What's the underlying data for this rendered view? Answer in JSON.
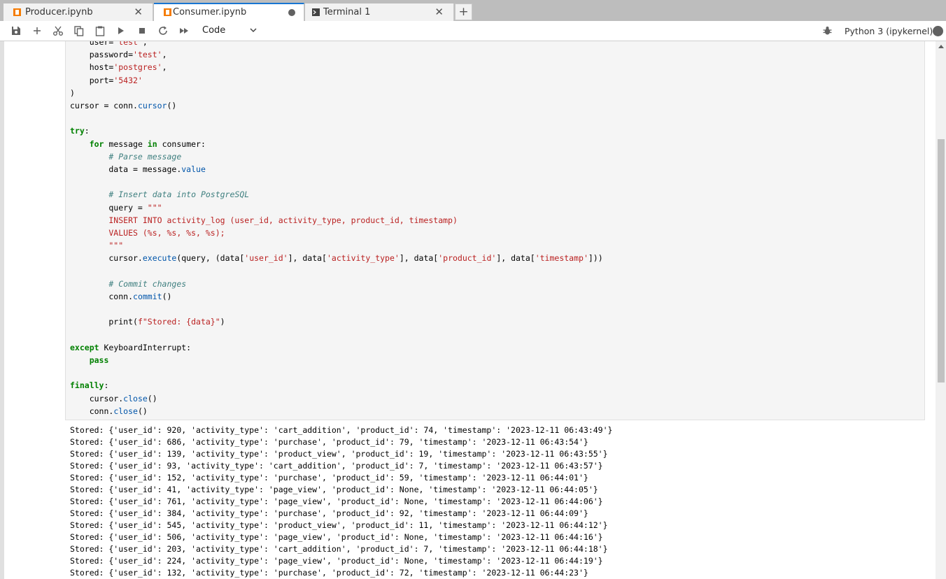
{
  "tabs": [
    {
      "label": "Producer.ipynb",
      "icon": "notebook-icon",
      "state": "close"
    },
    {
      "label": "Consumer.ipynb",
      "icon": "notebook-icon",
      "state": "unsaved"
    },
    {
      "label": "Terminal 1",
      "icon": "terminal-icon",
      "state": "close"
    }
  ],
  "toolbar": {
    "cell_type": "Code",
    "kernel": "Python 3 (ipykernel)",
    "buttons": [
      "save-icon",
      "add-cell-icon",
      "cut-icon",
      "copy-icon",
      "paste-icon",
      "run-icon",
      "stop-icon",
      "restart-icon",
      "fast-forward-icon"
    ]
  },
  "code_lines": [
    "    user='test',",
    "    password='test',",
    "    host='postgres',",
    "    port='5432'",
    ")",
    "cursor = conn.cursor()",
    "",
    "try:",
    "    for message in consumer:",
    "        # Parse message",
    "        data = message.value",
    "",
    "        # Insert data into PostgreSQL",
    "        query = \"\"\"",
    "        INSERT INTO activity_log (user_id, activity_type, product_id, timestamp)",
    "        VALUES (%s, %s, %s, %s);",
    "        \"\"\"",
    "        cursor.execute(query, (data['user_id'], data['activity_type'], data['product_id'], data['timestamp']))",
    "",
    "        # Commit changes",
    "        conn.commit()",
    "",
    "        print(f\"Stored: {data}\")",
    "",
    "except KeyboardInterrupt:",
    "    pass",
    "",
    "finally:",
    "    cursor.close()",
    "    conn.close()"
  ],
  "output_lines": [
    "Stored: {'user_id': 920, 'activity_type': 'cart_addition', 'product_id': 74, 'timestamp': '2023-12-11 06:43:49'}",
    "Stored: {'user_id': 686, 'activity_type': 'purchase', 'product_id': 79, 'timestamp': '2023-12-11 06:43:54'}",
    "Stored: {'user_id': 139, 'activity_type': 'product_view', 'product_id': 19, 'timestamp': '2023-12-11 06:43:55'}",
    "Stored: {'user_id': 93, 'activity_type': 'cart_addition', 'product_id': 7, 'timestamp': '2023-12-11 06:43:57'}",
    "Stored: {'user_id': 152, 'activity_type': 'purchase', 'product_id': 59, 'timestamp': '2023-12-11 06:44:01'}",
    "Stored: {'user_id': 41, 'activity_type': 'page_view', 'product_id': None, 'timestamp': '2023-12-11 06:44:05'}",
    "Stored: {'user_id': 761, 'activity_type': 'page_view', 'product_id': None, 'timestamp': '2023-12-11 06:44:06'}",
    "Stored: {'user_id': 384, 'activity_type': 'purchase', 'product_id': 92, 'timestamp': '2023-12-11 06:44:09'}",
    "Stored: {'user_id': 545, 'activity_type': 'product_view', 'product_id': 11, 'timestamp': '2023-12-11 06:44:12'}",
    "Stored: {'user_id': 506, 'activity_type': 'page_view', 'product_id': None, 'timestamp': '2023-12-11 06:44:16'}",
    "Stored: {'user_id': 203, 'activity_type': 'cart_addition', 'product_id': 7, 'timestamp': '2023-12-11 06:44:18'}",
    "Stored: {'user_id': 224, 'activity_type': 'page_view', 'product_id': None, 'timestamp': '2023-12-11 06:44:19'}",
    "Stored: {'user_id': 132, 'activity_type': 'purchase', 'product_id': 72, 'timestamp': '2023-12-11 06:44:23'}"
  ],
  "colors": {
    "accent": "#1976d2",
    "keyword": "#008000",
    "string": "#ba2121",
    "comment": "#408080",
    "notebook_icon": "#f57c00"
  }
}
